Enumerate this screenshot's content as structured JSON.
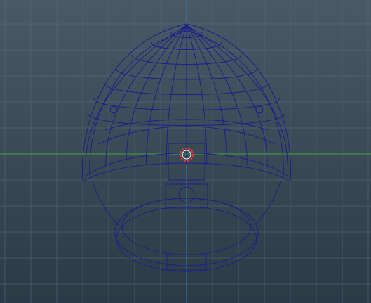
{
  "viewport": {
    "view_name": "front",
    "display_mode": "wireframe",
    "grid": true,
    "background_top": "#4a5966",
    "background_bottom": "#2c3a45",
    "grid_color": "#5b6a77",
    "axis_horizontal_color": "#3fa83f",
    "axis_vertical_color": "#2f7fbf"
  },
  "model": {
    "name": "helmet",
    "wire_color": "#1f1f8a",
    "icon": "helmet-wireframe"
  },
  "pivot": {
    "icon": "pivot-target-icon",
    "color": "#ff3030"
  }
}
